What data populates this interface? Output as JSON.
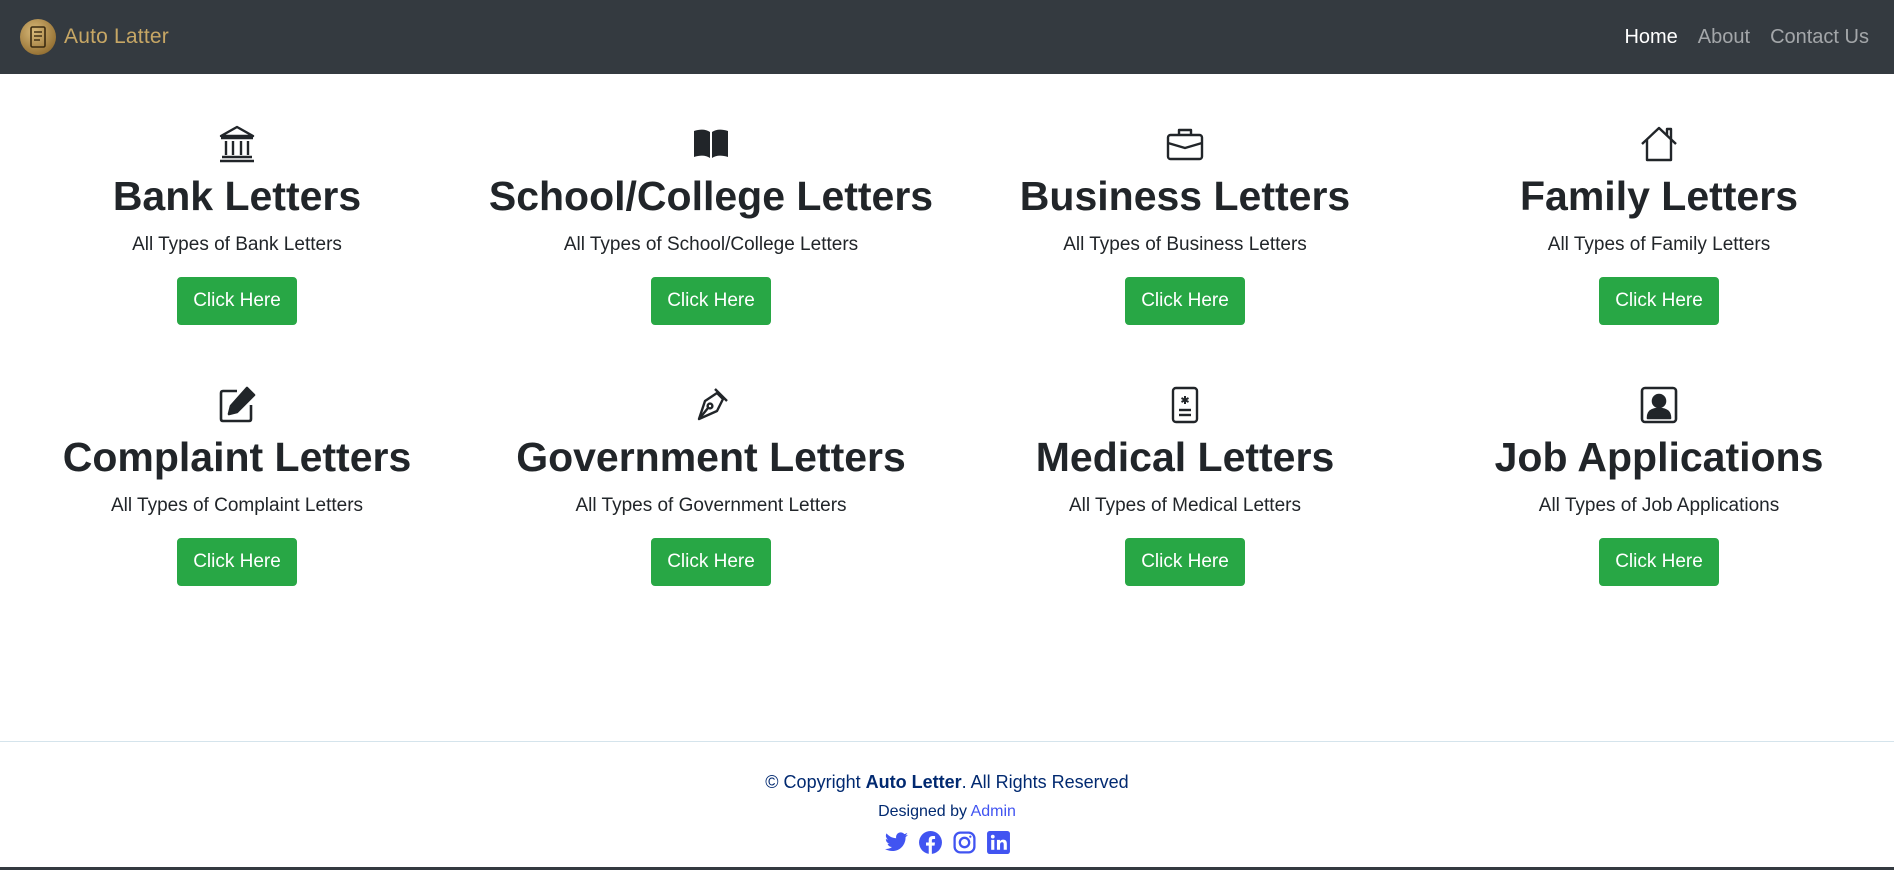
{
  "brand": {
    "name": "Auto Latter"
  },
  "nav": {
    "items": [
      {
        "label": "Home",
        "active": true
      },
      {
        "label": "About",
        "active": false
      },
      {
        "label": "Contact Us",
        "active": false
      }
    ]
  },
  "cards": [
    {
      "icon": "bank-icon",
      "title": "Bank Letters",
      "subtitle": "All Types of Bank Letters",
      "button": "Click Here"
    },
    {
      "icon": "book-icon",
      "title": "School/College Letters",
      "subtitle": "All Types of School/College Letters",
      "button": "Click Here"
    },
    {
      "icon": "briefcase-icon",
      "title": "Business Letters",
      "subtitle": "All Types of Business Letters",
      "button": "Click Here"
    },
    {
      "icon": "house-icon",
      "title": "Family Letters",
      "subtitle": "All Types of Family Letters",
      "button": "Click Here"
    },
    {
      "icon": "pencil-square-icon",
      "title": "Complaint Letters",
      "subtitle": "All Types of Complaint Letters",
      "button": "Click Here"
    },
    {
      "icon": "pen-nib-icon",
      "title": "Government Letters",
      "subtitle": "All Types of Government Letters",
      "button": "Click Here"
    },
    {
      "icon": "medical-badge-icon",
      "title": "Medical Letters",
      "subtitle": "All Types of Medical Letters",
      "button": "Click Here"
    },
    {
      "icon": "person-square-icon",
      "title": "Job Applications",
      "subtitle": "All Types of Job Applications",
      "button": "Click Here"
    }
  ],
  "footer": {
    "copyright_prefix": "© Copyright ",
    "copyright_brand": "Auto Letter",
    "copyright_suffix": ". All Rights Reserved",
    "designed_by_prefix": "Designed by ",
    "designed_by_link": "Admin",
    "socials": [
      "twitter-icon",
      "facebook-icon",
      "instagram-icon",
      "linkedin-icon"
    ]
  },
  "colors": {
    "navbar": "#343a40",
    "button": "#28a745",
    "footer_text": "#012970",
    "footer_link": "#4154f1"
  }
}
